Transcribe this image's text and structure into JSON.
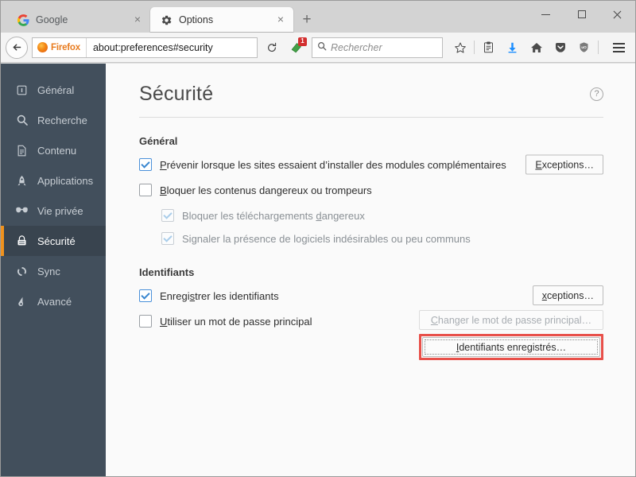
{
  "window": {
    "controls": {
      "minimize": "minimize-button",
      "maximize": "maximize-button",
      "close": "close-button"
    }
  },
  "tabs": [
    {
      "label": "Google",
      "favicon": "google-icon",
      "active": false,
      "close": "×"
    },
    {
      "label": "Options",
      "favicon": "gear-icon",
      "active": true,
      "close": "×"
    }
  ],
  "newtab_label": "+",
  "navbar": {
    "back_glyph": "←",
    "identity_label": "Firefox",
    "url": "about:preferences#security",
    "reload_glyph": "⟳",
    "extension_badge": "1",
    "search_placeholder": "Rechercher",
    "icons": [
      "bookmark-star-icon",
      "library-icon",
      "download-icon",
      "home-icon",
      "pocket-icon",
      "ublock-shield-icon"
    ],
    "menu_label": "menu-button"
  },
  "sidebar": {
    "items": [
      {
        "label": "Général",
        "icon": "general-icon",
        "selected": false
      },
      {
        "label": "Recherche",
        "icon": "search-icon",
        "selected": false
      },
      {
        "label": "Contenu",
        "icon": "document-icon",
        "selected": false
      },
      {
        "label": "Applications",
        "icon": "rocket-icon",
        "selected": false
      },
      {
        "label": "Vie privée",
        "icon": "mask-icon",
        "selected": false
      },
      {
        "label": "Sécurité",
        "icon": "lock-icon",
        "selected": true
      },
      {
        "label": "Sync",
        "icon": "sync-icon",
        "selected": false
      },
      {
        "label": "Avancé",
        "icon": "gear-advanced-icon",
        "selected": false
      }
    ],
    "accent_color": "#f0921e",
    "background_color": "#424f5c"
  },
  "pane": {
    "title": "Sécurité",
    "help_glyph": "?",
    "sections": [
      {
        "title": "Général",
        "rows": [
          {
            "label_prefix": "",
            "accesskey": "P",
            "label_rest": "révenir lorsque les sites essaient d’installer des modules complémentaires",
            "checked": true,
            "disabled": false,
            "sub": false,
            "button": "Exceptions…",
            "button_accesskey": "E"
          },
          {
            "label_prefix": "",
            "accesskey": "B",
            "label_rest": "loquer les contenus dangereux ou trompeurs",
            "checked": false,
            "disabled": false,
            "sub": false,
            "button": null
          },
          {
            "label_prefix": "Bloquer les téléchargements ",
            "accesskey": "d",
            "label_rest": "angereux",
            "checked": true,
            "disabled": true,
            "sub": true,
            "button": null
          },
          {
            "label_prefix": "Si",
            "accesskey": "g",
            "label_rest": "naler la présence de logiciels indésirables ou peu communs",
            "checked": true,
            "disabled": true,
            "sub": true,
            "button": null
          }
        ]
      }
    ],
    "identifiants": {
      "title": "Identifiants",
      "row1": {
        "label_prefix": "Enregi",
        "accesskey": "s",
        "label_rest": "trer les identifiants",
        "checked": true
      },
      "row2": {
        "label_prefix": "",
        "accesskey": "U",
        "label_rest": "tiliser un mot de passe principal",
        "checked": false
      },
      "exceptions_button": {
        "prefix": "E",
        "accesskey": "x",
        "rest": "ceptions…"
      },
      "change_master_button": {
        "prefix": "",
        "accesskey": "C",
        "rest": "hanger le mot de passe principal…",
        "disabled": true
      },
      "saved_logins_button": {
        "prefix": "",
        "accesskey": "I",
        "rest": "dentifiants enregistrés…",
        "highlighted": true
      },
      "highlight_color": "#e8504a"
    }
  }
}
